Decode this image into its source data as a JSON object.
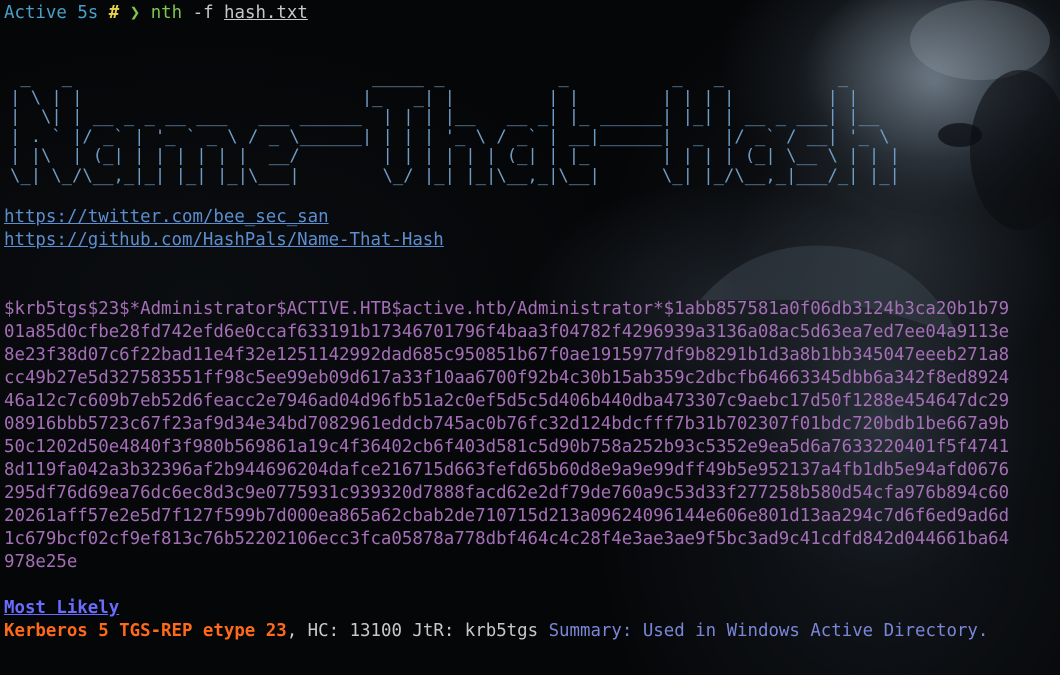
{
  "prompt": {
    "dir": "Active",
    "duration": "5s",
    "hash_symbol": "#",
    "arrow": "❯",
    "command": "nth",
    "flag": "-f",
    "file": "hash.txt"
  },
  "banner": {
    "ascii": [
      " _   _                             _____ _           _          _   _           _     ",
      "| \\ | |                           |_   _| |         | |        | | | |         | |    ",
      "|  \\| | __ _ _ __ ___   ___ ______  | | | |__   __ _| |_ ______| |_| | __ _ ___| |__  ",
      "| . ` |/ _` | '_ ` _ \\ / _ \\______| | | | '_ \\ / _` | __|______|  _  |/ _` / __| '_ \\ ",
      "| |\\  | (_| | | | | | |  __/        | | | | | | (_| | |_       | | | | (_| \\__ \\ | | |",
      "\\_| \\_/\\__,_|_| |_| |_|\\___|        \\_/ |_| |_|\\__,_|\\__|      \\_| |_/\\__,_|___/_| |_|"
    ],
    "links": [
      "https://twitter.com/bee_sec_san",
      "https://github.com/HashPals/Name-That-Hash"
    ]
  },
  "hash_lines": [
    "$krb5tgs$23$*Administrator$ACTIVE.HTB$active.htb/Administrator*$1abb857581a0f06db3124b3ca20b1b79",
    "01a85d0cfbe28fd742efd6e0ccaf633191b17346701796f4baa3f04782f4296939a3136a08ac5d63ea7ed7ee04a9113e",
    "8e23f38d07c6f22bad11e4f32e1251142992dad685c950851b67f0ae1915977df9b8291b1d3a8b1bb345047eeeb271a8",
    "cc49b27e5d327583551ff98c5ee99eb09d617a33f10aa6700f92b4c30b15ab359c2dbcfb64663345dbb6a342f8ed8924",
    "46a12c7c609b7eb52d6feacc2e7946ad04d96fb51a2c0ef5d5c5d406b440dba473307c9aebc17d50f1288e454647dc29",
    "08916bbb5723c67f23af9d34e34bd7082961eddcb745ac0b76fc32d124bdcfff7b31b702307f01bdc720bdb1be667a9b",
    "50c1202d50e4840f3f980b569861a19c4f36402cb6f403d581c5d90b758a252b93c5352e9ea5d6a7633220401f5f4741",
    "8d119fa042a3b32396af2b944696204dafce216715d663fefd65b60d8e9a9e99dff49b5e952137a4fb1db5e94afd0676",
    "295df76d69ea76dc6ec8d3c9e0775931c939320d7888facd62e2df79de760a9c53d33f277258b580d54cfa976b894c60",
    "20261aff57e2e5d7f127f599b7d000ea865a62cbab2de710715d213a09624096144e606e801d13aa294c7d6f6ed9ad6d",
    "1c679bcf02cf9ef813c76b52202106ecc3fca05878a778dbf464c4c28f4e3ae3ae9f5bc3ad9c41cdfd842d044661ba64",
    "978e25e"
  ],
  "results": {
    "heading": "Most Likely",
    "name": "Kerberos 5 TGS-REP etype 23",
    "hc_label": "HC:",
    "hc_value": "13100",
    "jtr_label": "JtR:",
    "jtr_value": "krb5tgs",
    "summary_label": "Summary:",
    "summary_value": "Used in Windows Active Directory."
  },
  "colors": {
    "background": "#050608",
    "banner": "#6f9cc6",
    "links": "#5b8fd0",
    "hash": "#a46fb6",
    "heading": "#6a6cff",
    "result_name": "#ff6a1a",
    "summary": "#7a86d8"
  }
}
